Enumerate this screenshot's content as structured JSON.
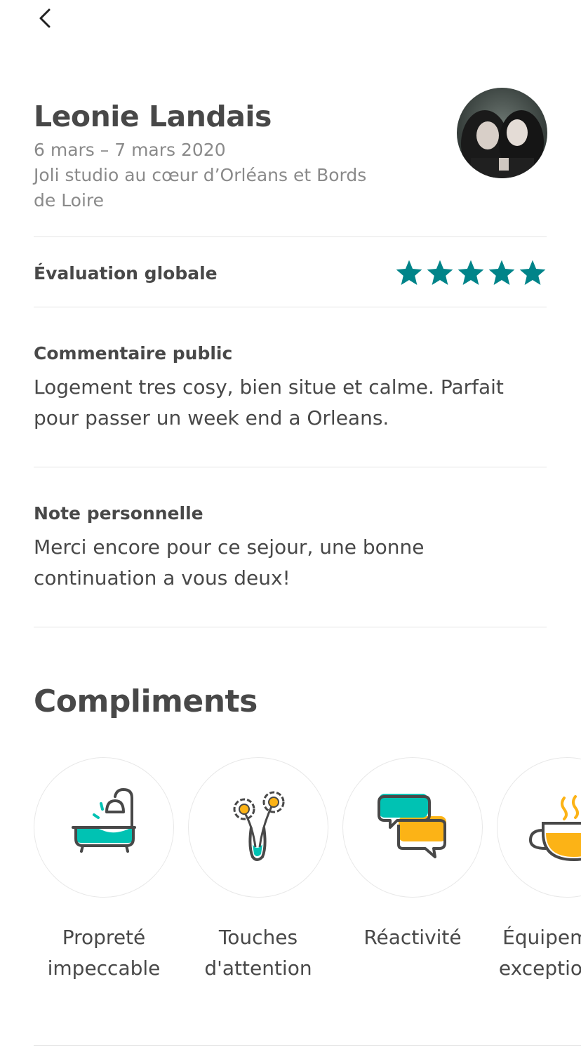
{
  "header": {
    "guest_name": "Leonie Landais",
    "dates": "6 mars – 7 mars 2020",
    "listing": "Joli studio au cœur d’Orléans et Bords de Loire"
  },
  "overall": {
    "label": "Évaluation globale",
    "rating": 5,
    "max": 5,
    "star_color": "#008489"
  },
  "public_comment": {
    "label": "Commentaire public",
    "text": "Logement tres cosy, bien situe et calme. Parfait pour passer un week end a Orleans."
  },
  "private_note": {
    "label": "Note personnelle",
    "text": "Merci encore pour ce sejour, une bonne continuation a vous deux!"
  },
  "compliments": {
    "title": "Compliments",
    "items": [
      {
        "label": "Propreté impeccable",
        "icon": "bathtub-icon"
      },
      {
        "label": "Touches d'attention",
        "icon": "flowers-vase-icon"
      },
      {
        "label": "Réactivité",
        "icon": "chat-bubbles-icon"
      },
      {
        "label": "Équipements exceptionnels",
        "icon": "coffee-cup-icon"
      }
    ]
  },
  "colors": {
    "teal": "#00c2b3",
    "amber": "#fcb316",
    "text": "#484848",
    "muted": "#8a8a8a"
  }
}
